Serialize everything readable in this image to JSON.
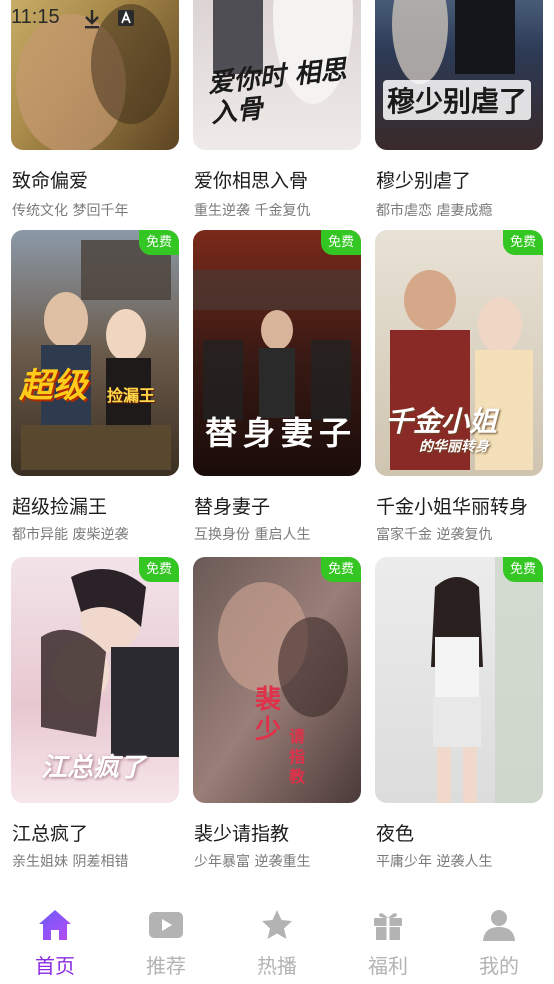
{
  "status_bar": {
    "time": "11:15"
  },
  "badge_label": "免费",
  "colors": {
    "accent": "#8a2be2",
    "badge": "#34c724",
    "tab_inactive": "#b3b3b3"
  },
  "rows": [
    [
      {
        "title": "致命偏爱",
        "tags": "传统文化 梦回千年",
        "free": false,
        "poster_text": ""
      },
      {
        "title": "爱你相思入骨",
        "tags": "重生逆袭 千金复仇",
        "free": false,
        "poster_text": "爱你时 相思入骨"
      },
      {
        "title": "穆少别虐了",
        "tags": "都市虐恋 虐妻成瘾",
        "free": false,
        "poster_text": "穆少别虐了"
      }
    ],
    [
      {
        "title": "超级捡漏王",
        "tags": "都市异能 废柴逆袭",
        "free": true,
        "poster_text": "超级",
        "poster_subtext": "捡漏王"
      },
      {
        "title": "替身妻子",
        "tags": "互换身份 重启人生",
        "free": true,
        "poster_text": "替身妻子"
      },
      {
        "title": "千金小姐华丽转身",
        "tags": "富家千金 逆袭复仇",
        "free": true,
        "poster_text": "千金小姐",
        "poster_subtext": "的华丽转身"
      }
    ],
    [
      {
        "title": "江总疯了",
        "tags": "亲生姐妹 阴差相错",
        "free": true,
        "poster_text": "江总疯了"
      },
      {
        "title": "裴少请指教",
        "tags": "少年暴富 逆袭重生",
        "free": true,
        "poster_text": "裴少",
        "poster_subtext": "请指教"
      },
      {
        "title": "夜色",
        "tags": "平庸少年 逆袭人生",
        "free": true,
        "poster_text": ""
      }
    ]
  ],
  "tabs": [
    {
      "label": "首页",
      "icon": "home-icon",
      "active": true
    },
    {
      "label": "推荐",
      "icon": "play-icon",
      "active": false
    },
    {
      "label": "热播",
      "icon": "star-icon",
      "active": false
    },
    {
      "label": "福利",
      "icon": "gift-icon",
      "active": false
    },
    {
      "label": "我的",
      "icon": "user-icon",
      "active": false
    }
  ]
}
